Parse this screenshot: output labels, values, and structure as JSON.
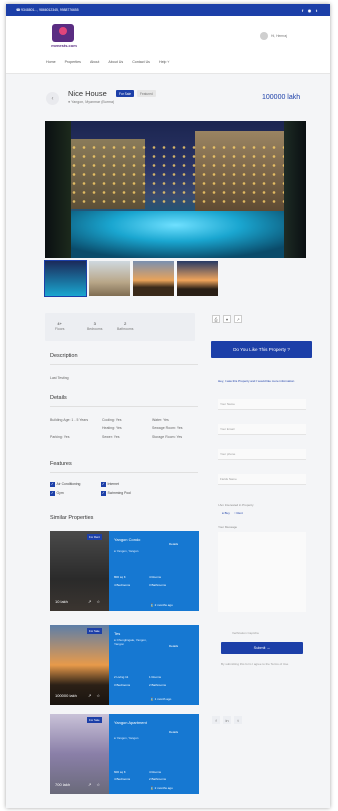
{
  "topbar": {
    "phones": "☎ 9348801..., 9866012345, 9988776655",
    "social": [
      "f",
      "◉",
      "t"
    ]
  },
  "header": {
    "logo_text": "mvnests.com",
    "user_name": "Hi, Hemraj",
    "nav": [
      "Home",
      "Properties",
      "About",
      "About Us",
      "Contact Us",
      "Help ˅"
    ]
  },
  "property": {
    "title": "Nice House",
    "badge_sale": "For Sale",
    "badge_featured": "Featured",
    "location": "● Yangon, Myanmar (Burma)",
    "price": "100000 lakh"
  },
  "stats": [
    {
      "value": "4+",
      "label": "Floors"
    },
    {
      "value": "3",
      "label": "Bedrooms"
    },
    {
      "value": "2",
      "label": "Bathrooms"
    }
  ],
  "action_icons": [
    "⎙",
    "♥",
    "↗"
  ],
  "sections": {
    "description": "Description",
    "description_text": "Last Testing",
    "details": "Details",
    "features": "Features",
    "similar": "Similar Properties"
  },
  "details": [
    [
      "Building Age: 1 - 5 Years",
      "Cooling: Yes",
      "Water: Yes"
    ],
    [
      "Parking: Yes",
      "Heating: Yes",
      "Sewage Room: Yes"
    ],
    [
      "",
      "Sewer: Yes",
      "Storage Room: Yes"
    ]
  ],
  "features": [
    [
      "Air Conditioning",
      "Internet"
    ],
    [
      "Gym",
      "Swimming Pool"
    ]
  ],
  "similar": [
    {
      "tag": "For Rent",
      "price": "10 lakh",
      "title": "Yangon Condo",
      "address": "● Yangon, Yangon",
      "details": "Details",
      "f1": "800 sq ft",
      "f2": "4 Rooms",
      "f3": "4 Bedrooms",
      "f4": "3 Bathrooms",
      "ago": "⌛ 2 months ago"
    },
    {
      "tag": "For Sale",
      "price": "100000 lakh",
      "title": "Tes",
      "address": "● Chunglingale, Yangon, Yangon",
      "details": "Details",
      "f1": "2 Living 11",
      "f2": "1 Rooms",
      "f3": "3 Bedrooms",
      "f4": "2 Bathrooms",
      "ago": "⌛ 1 month ago"
    },
    {
      "tag": "For Sale",
      "price": "700 lakh",
      "title": "Yangon Apartment",
      "address": "● Yangon, Yangon",
      "details": "Details",
      "f1": "600 sq ft",
      "f2": "4 Rooms",
      "f3": "4 Bedrooms",
      "f4": "2 Bathrooms",
      "ago": "⌛ 2 months ago"
    }
  ],
  "card_icons": "↗ ☆",
  "sidebar": {
    "like_button": "Do You Like This Property ?",
    "form_note": "Hey, I saw this Property and I would like more information",
    "fields": [
      "Your Name",
      "Your Email",
      "Your phone",
      "Fields Name"
    ],
    "interest_label": "I Am Interested in Property",
    "radios": [
      "● Buy",
      "○ Rent"
    ],
    "message_label": "Your Message",
    "captcha": "Verification Captcha",
    "submit": "Submit →",
    "terms": "By submitting this form I agree to the Terms of Use"
  },
  "share_icons": [
    "f",
    "in",
    "t"
  ]
}
